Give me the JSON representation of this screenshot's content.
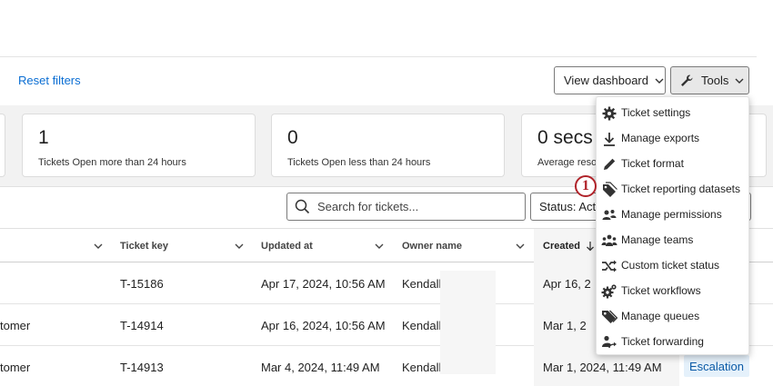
{
  "toolbar": {
    "reset_filters": "Reset filters",
    "view_dashboard": "View dashboard",
    "tools": "Tools"
  },
  "stats": [
    {
      "value": "1",
      "label": "Tickets Open more than 24 hours"
    },
    {
      "value": "0",
      "label": "Tickets Open less than 24 hours"
    },
    {
      "value": "0 secs",
      "label": "Average resol"
    }
  ],
  "search": {
    "placeholder": "Search for tickets..."
  },
  "status_filter": {
    "value": "Status: Acti"
  },
  "table": {
    "headers": {
      "ticket_key": "Ticket key",
      "updated_at": "Updated at",
      "owner_name": "Owner name",
      "created": "Created"
    },
    "rows": [
      {
        "col0": "",
        "ticket_key": "T-15186",
        "updated_at": "Apr 17, 2024, 10:56 AM",
        "owner": "Kendall",
        "created": "Apr 16, 2"
      },
      {
        "col0": "tomer",
        "ticket_key": "T-14914",
        "updated_at": "Apr 16, 2024, 10:56 AM",
        "owner": "Kendall",
        "created": "Mar 1, 2"
      },
      {
        "col0": "tomer",
        "ticket_key": "T-14913",
        "updated_at": "Mar 4, 2024, 11:49 AM",
        "owner": "Kendall",
        "created": "Mar 1, 2024, 11:49 AM"
      }
    ],
    "escalation_badge": "Escalation"
  },
  "tools_menu": [
    {
      "label": "Ticket settings",
      "icon": "gear-icon"
    },
    {
      "label": "Manage exports",
      "icon": "download-icon"
    },
    {
      "label": "Ticket format",
      "icon": "pencil-icon"
    },
    {
      "label": "Ticket reporting datasets",
      "icon": "tag-stack-icon"
    },
    {
      "label": "Manage permissions",
      "icon": "users-key-icon"
    },
    {
      "label": "Manage teams",
      "icon": "team-icon"
    },
    {
      "label": "Custom ticket status",
      "icon": "shuffle-icon"
    },
    {
      "label": "Ticket workflows",
      "icon": "gears-icon"
    },
    {
      "label": "Manage queues",
      "icon": "tags-icon"
    },
    {
      "label": "Ticket forwarding",
      "icon": "user-forward-icon"
    }
  ],
  "step_marker": "1",
  "colors": {
    "link": "#0b6ed3",
    "marker": "#b0232a",
    "badge_bg": "#e5f1fb"
  }
}
